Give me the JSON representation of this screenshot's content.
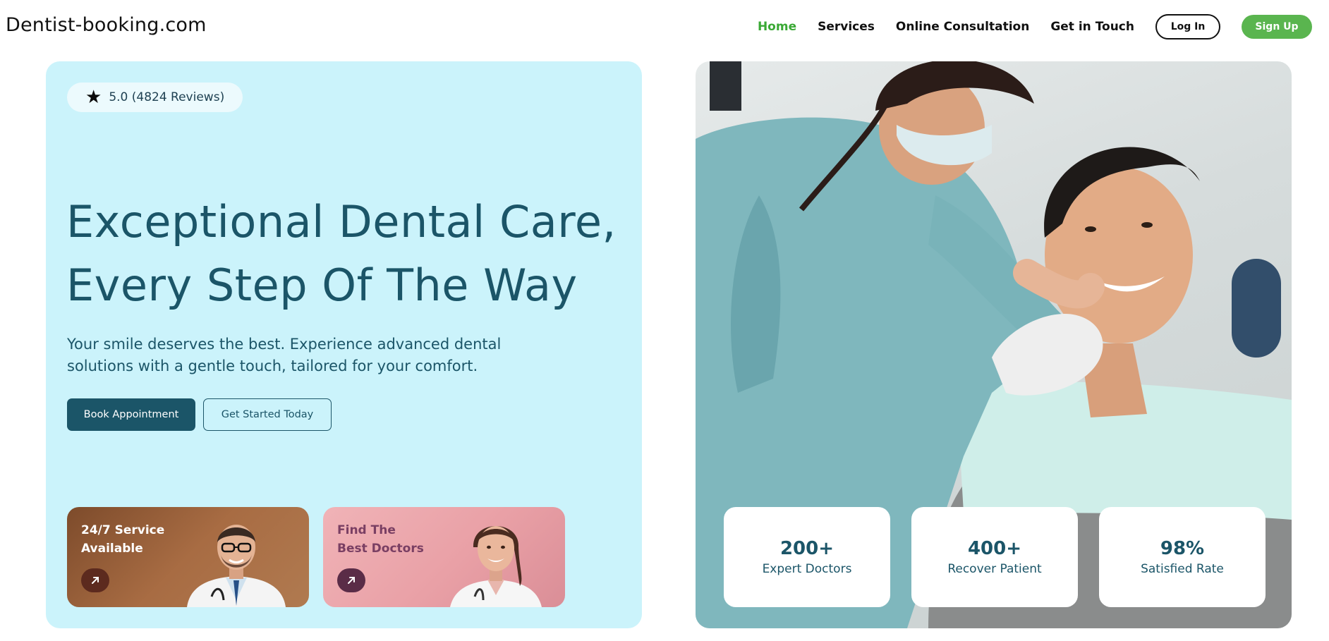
{
  "header": {
    "logo": "Dentist-booking.com",
    "nav": [
      {
        "label": "Home",
        "active": true
      },
      {
        "label": "Services",
        "active": false
      },
      {
        "label": "Online Consultation",
        "active": false
      },
      {
        "label": "Get in Touch",
        "active": false
      }
    ],
    "login_label": "Log In",
    "signup_label": "Sign Up",
    "accent_color": "#3aa935"
  },
  "hero": {
    "rating_icon": "star-icon",
    "rating_text": "5.0 (4824 Reviews)",
    "title_line1": "Exceptional Dental Care,",
    "title_line2": "Every Step Of The Way",
    "subtitle": "Your smile deserves the best. Experience advanced dental solutions with a gentle touch, tailored for your comfort.",
    "primary_cta": "Book Appointment",
    "secondary_cta": "Get Started Today",
    "panel_color": "#cbf3fb",
    "text_color": "#1b5568"
  },
  "promos": [
    {
      "line1": "24/7 Service",
      "line2": "Available",
      "icon": "arrow-up-right-icon"
    },
    {
      "line1": "Find The",
      "line2": "Best Doctors",
      "icon": "arrow-up-right-icon"
    }
  ],
  "stats": [
    {
      "value": "200+",
      "label": "Expert Doctors"
    },
    {
      "value": "400+",
      "label": "Recover Patient"
    },
    {
      "value": "98%",
      "label": "Satisfied Rate"
    }
  ]
}
